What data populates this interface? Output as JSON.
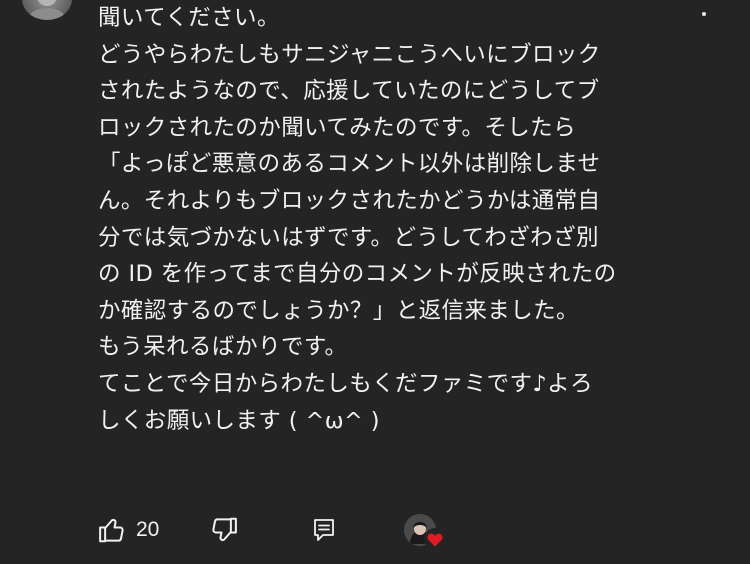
{
  "comment": {
    "lines": [
      "聞いてください。",
      "どうやらわたしもサニジャニこうへいにブロック",
      "されたようなので、応援していたのにどうしてブ",
      "ロックされたのか聞いてみたのです。そしたら",
      "「よっぽど悪意のあるコメント以外は削除しませ",
      "ん。それよりもブロックされたかどうかは通常自",
      "分では気づかないはずです。どうしてわざわざ別",
      "の ID を作ってまで自分のコメントが反映されたの",
      "か確認するのでしょうか？」と返信来ました。",
      "もう呆れるばかりです。",
      "てことで今日からわたしもくだファミです♪よろ",
      "しくお願いします ( ^ω^ )"
    ]
  },
  "actions": {
    "like_count": "20",
    "like_icon": "thumbs-up-icon",
    "dislike_icon": "thumbs-down-icon",
    "reply_icon": "reply-icon",
    "heart_icon": "creator-heart-icon"
  },
  "colors": {
    "background": "#242424",
    "text": "#f1f1f1",
    "heart": "#e01b24"
  }
}
